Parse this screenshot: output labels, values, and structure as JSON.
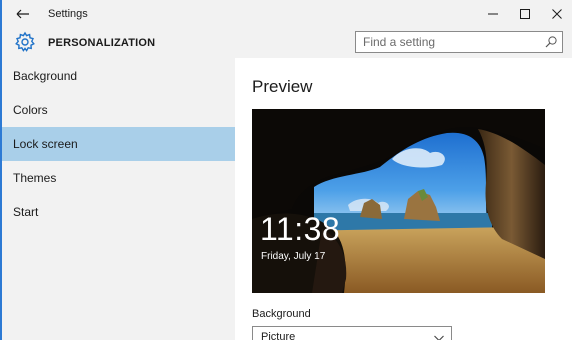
{
  "window": {
    "title": "Settings"
  },
  "header": {
    "section_title": "PERSONALIZATION",
    "search_placeholder": "Find a setting"
  },
  "sidebar": {
    "items": [
      {
        "label": "Background",
        "selected": false
      },
      {
        "label": "Colors",
        "selected": false
      },
      {
        "label": "Lock screen",
        "selected": true
      },
      {
        "label": "Themes",
        "selected": false
      },
      {
        "label": "Start",
        "selected": false
      }
    ]
  },
  "content": {
    "heading": "Preview",
    "lock_time": "11:38",
    "lock_date": "Friday, July 17",
    "background_label": "Background",
    "background_value": "Picture"
  },
  "icons": {
    "back": "back-arrow-icon",
    "gear": "gear-icon",
    "search": "search-icon",
    "minimize": "minimize-icon",
    "maximize": "maximize-icon",
    "close": "close-icon",
    "chevron": "chevron-down-icon"
  },
  "colors": {
    "accent_border": "#2d7ad4",
    "selected_item": "#a9cfe9",
    "icon_blue": "#1f72c8"
  }
}
